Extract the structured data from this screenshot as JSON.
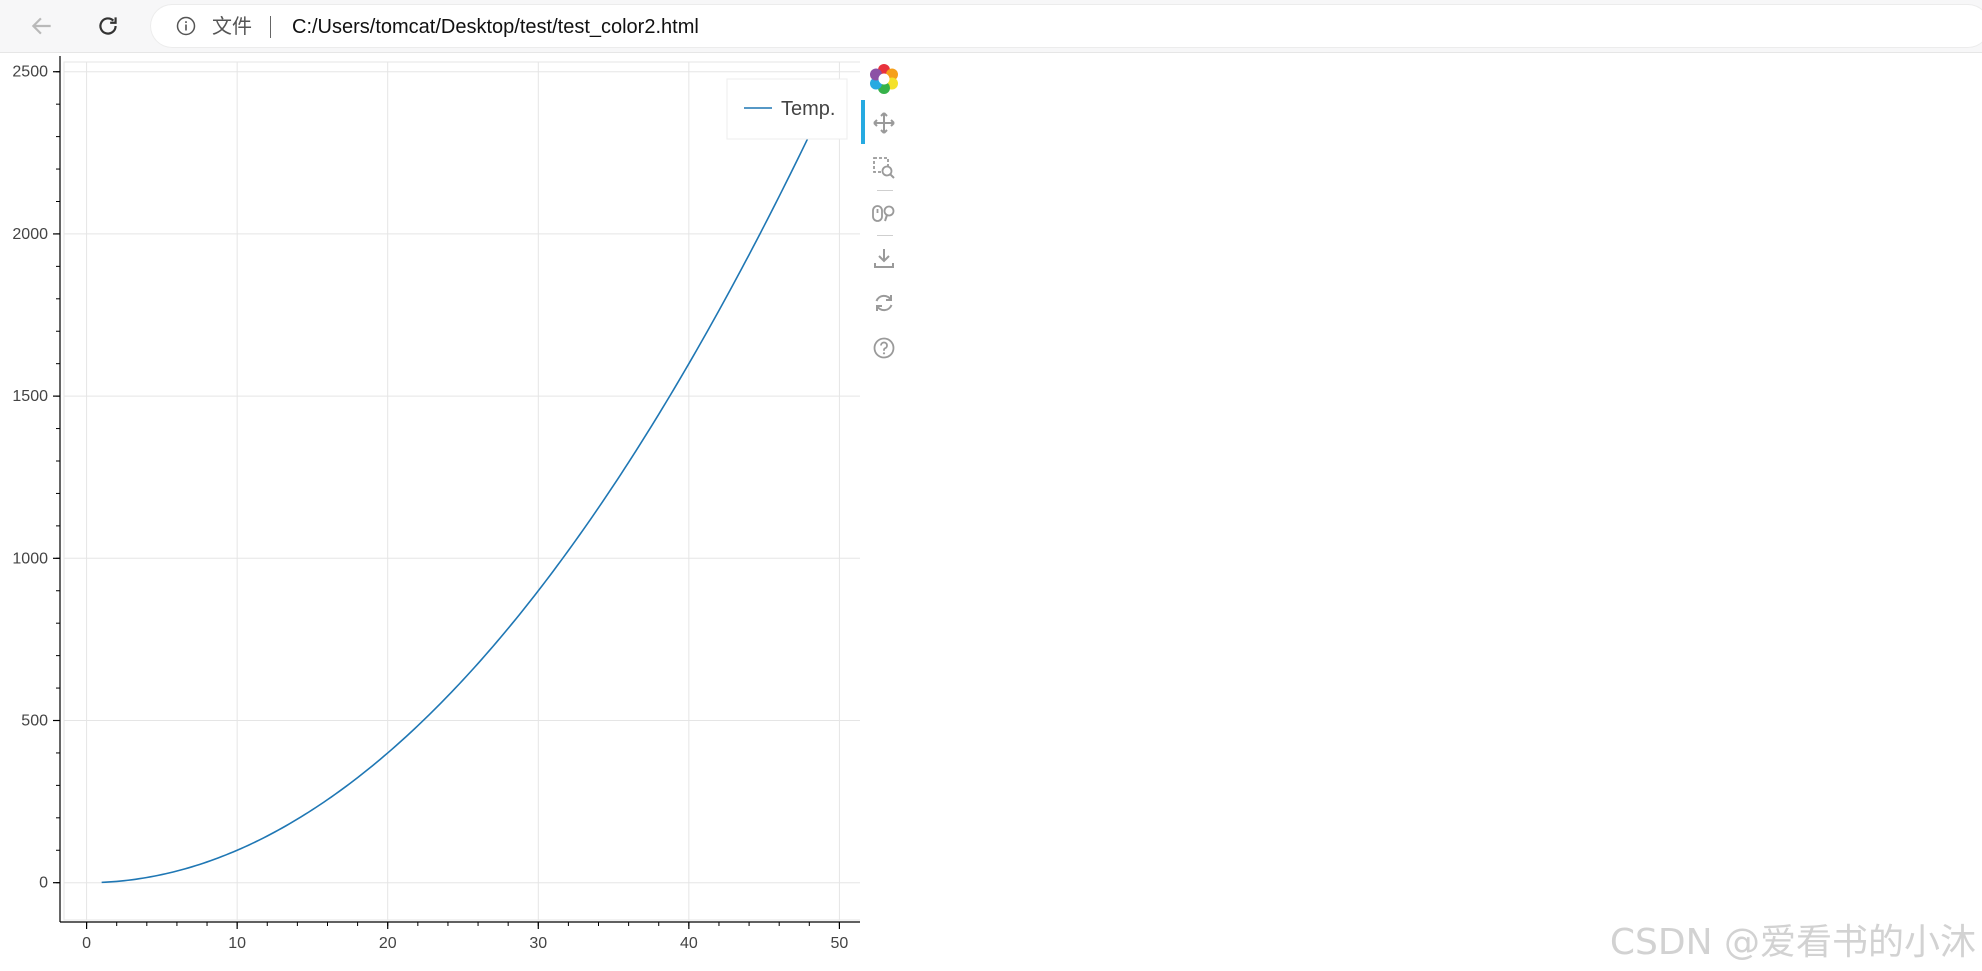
{
  "browser": {
    "scheme_label": "文件",
    "url": "C:/Users/tomcat/Desktop/test/test_color2.html"
  },
  "chart_data": {
    "type": "line",
    "series": [
      {
        "name": "Temp.",
        "color": "#1f77b4",
        "function": "y = x^2",
        "x_start": 1,
        "x_end": 48.5
      }
    ],
    "xlim": [
      -1.5,
      51.5
    ],
    "ylim": [
      -115,
      2530
    ],
    "x_ticks": [
      0,
      10,
      20,
      30,
      40,
      50
    ],
    "y_ticks": [
      0,
      500,
      1000,
      1500,
      2000,
      2500
    ],
    "x_tick_labels": [
      "0",
      "10",
      "20",
      "30",
      "40",
      "50"
    ],
    "y_tick_labels": [
      "0",
      "500",
      "1000",
      "1500",
      "2000",
      "2500"
    ],
    "x_minor_step": 2,
    "y_minor_step": 100,
    "grid": true,
    "legend_placement": "top-right",
    "legend": [
      "Temp."
    ]
  },
  "toolbar": {
    "tools": [
      "bokeh-logo-icon",
      "pan-icon",
      "box-zoom-icon",
      "wheel-zoom-icon",
      "save-icon",
      "reset-icon",
      "help-icon"
    ],
    "active": "pan-icon"
  },
  "watermark": "CSDN @爱看书的小沐"
}
